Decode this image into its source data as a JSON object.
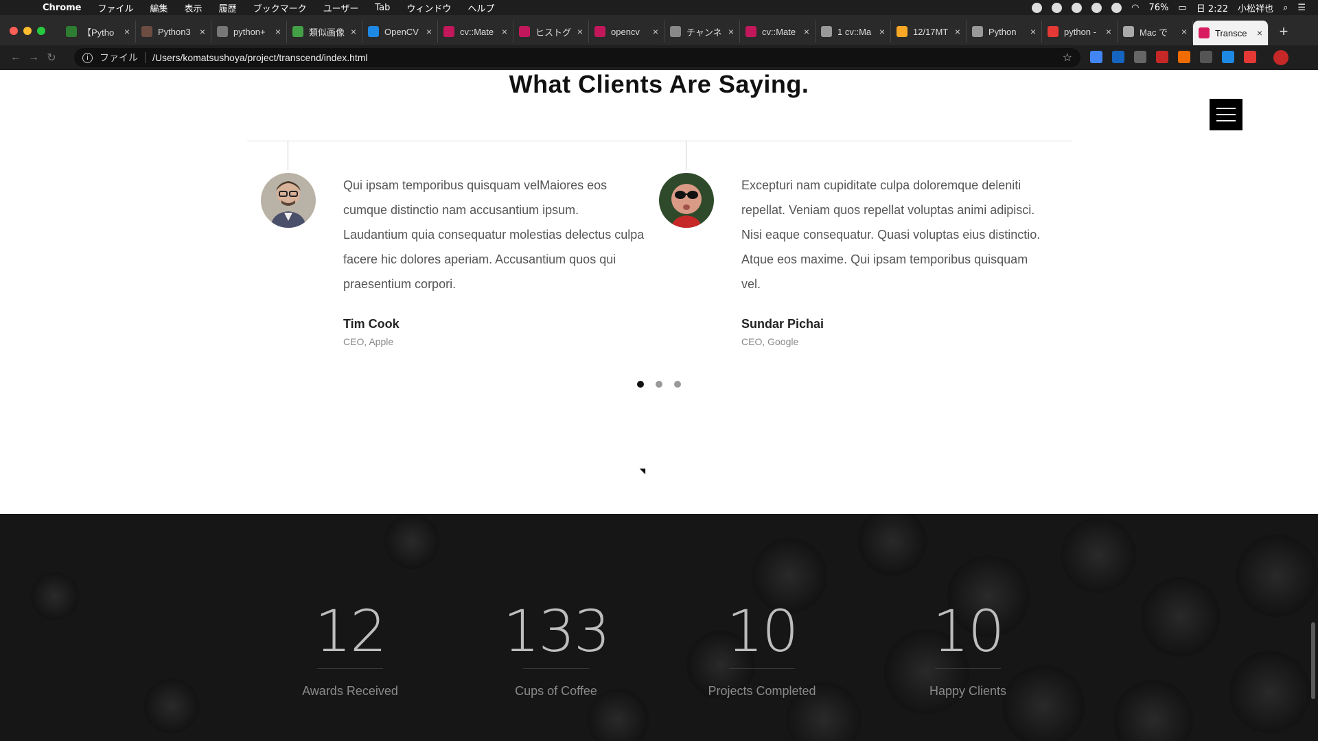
{
  "menubar": {
    "app": "Chrome",
    "items": [
      "ファイル",
      "編集",
      "表示",
      "履歴",
      "ブックマーク",
      "ユーザー",
      "Tab",
      "ウィンドウ",
      "ヘルプ"
    ],
    "battery": "76%",
    "clock": "日 2:22",
    "user": "小松祥也"
  },
  "tabs": [
    {
      "label": "【Pytho",
      "color": "#2e7d32"
    },
    {
      "label": "Python3",
      "color": "#6d4c41"
    },
    {
      "label": "python+",
      "color": "#777777"
    },
    {
      "label": "類似画像",
      "color": "#43a047"
    },
    {
      "label": "OpenCV",
      "color": "#1e88e5"
    },
    {
      "label": "cv::Mate",
      "color": "#c2185b"
    },
    {
      "label": "ヒストグ",
      "color": "#c2185b"
    },
    {
      "label": "opencv",
      "color": "#c2185b"
    },
    {
      "label": "チャンネ",
      "color": "#888888"
    },
    {
      "label": "cv::Mate",
      "color": "#c2185b"
    },
    {
      "label": "1 cv::Ma",
      "color": "#999999"
    },
    {
      "label": "12/17MT",
      "color": "#f9a825"
    },
    {
      "label": "Python",
      "color": "#999999"
    },
    {
      "label": "python -",
      "color": "#e53935"
    },
    {
      "label": "Mac で",
      "color": "#aaaaaa"
    },
    {
      "label": "Transce",
      "color": "#d81b60",
      "active": true
    }
  ],
  "omnibox": {
    "scheme_label": "ファイル",
    "url": "/Users/komatsushoya/project/transcend/index.html"
  },
  "section": {
    "title": "What Clients Are Saying."
  },
  "testimonials": [
    {
      "quote": "Qui ipsam temporibus quisquam velMaiores eos cumque distinctio nam accusantium ipsum. Laudantium quia consequatur molestias delectus culpa facere hic dolores aperiam. Accusantium quos qui praesentium corpori.",
      "name": "Tim Cook",
      "role": "CEO, Apple"
    },
    {
      "quote": "Excepturi nam cupiditate culpa doloremque deleniti repellat. Veniam quos repellat voluptas animi adipisci. Nisi eaque consequatur. Quasi voluptas eius distinctio. Atque eos maxime. Qui ipsam temporibus quisquam vel.",
      "name": "Sundar Pichai",
      "role": "CEO, Google"
    }
  ],
  "carousel": {
    "pages": 3,
    "active_index": 0
  },
  "stats": [
    {
      "value": "12",
      "label": "Awards Received"
    },
    {
      "value": "133",
      "label": "Cups of Coffee"
    },
    {
      "value": "10",
      "label": "Projects Completed"
    },
    {
      "value": "10",
      "label": "Happy Clients"
    }
  ]
}
